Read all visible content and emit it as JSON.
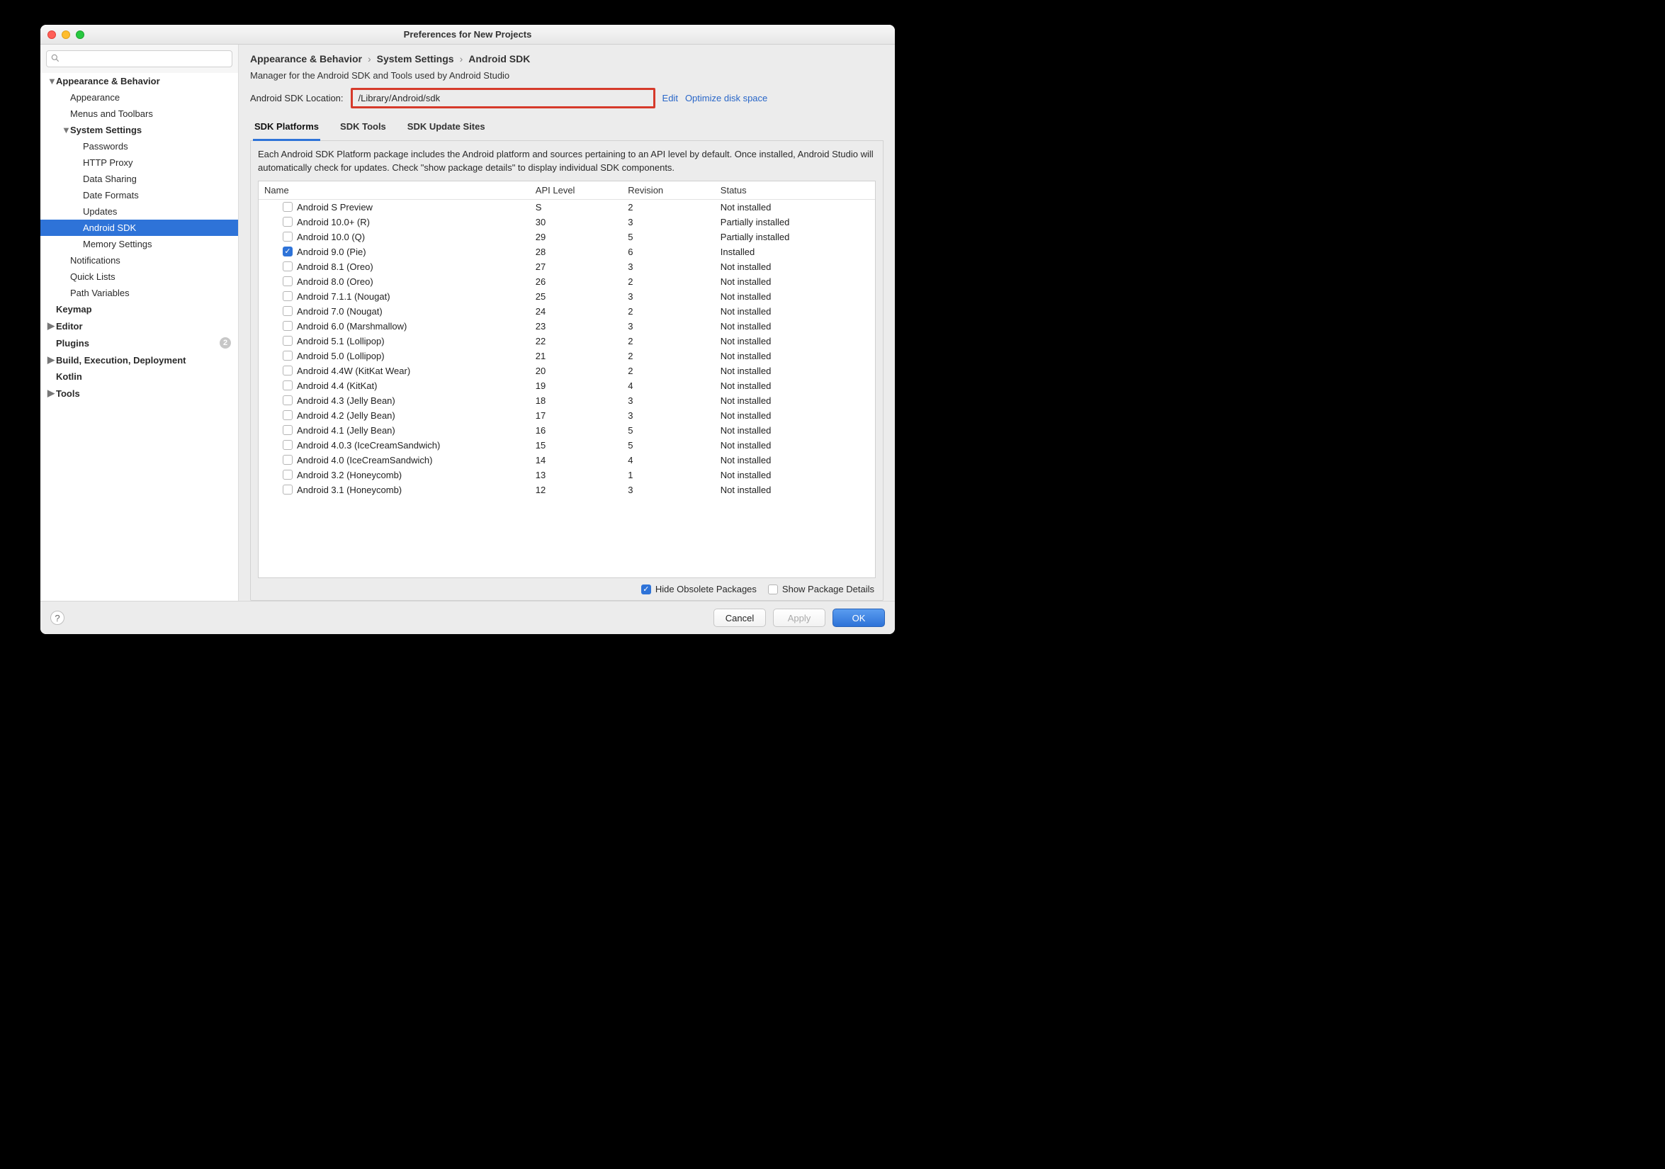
{
  "window": {
    "title": "Preferences for New Projects"
  },
  "sidebar": {
    "search_placeholder": "",
    "items": [
      {
        "label": "Appearance & Behavior",
        "bold": true,
        "expand": "down",
        "indent": 0
      },
      {
        "label": "Appearance",
        "indent": 1
      },
      {
        "label": "Menus and Toolbars",
        "indent": 1
      },
      {
        "label": "System Settings",
        "bold": true,
        "expand": "down",
        "indent": 1
      },
      {
        "label": "Passwords",
        "indent": 2
      },
      {
        "label": "HTTP Proxy",
        "indent": 2
      },
      {
        "label": "Data Sharing",
        "indent": 2
      },
      {
        "label": "Date Formats",
        "indent": 2
      },
      {
        "label": "Updates",
        "indent": 2
      },
      {
        "label": "Android SDK",
        "indent": 2,
        "selected": true
      },
      {
        "label": "Memory Settings",
        "indent": 2
      },
      {
        "label": "Notifications",
        "indent": 1
      },
      {
        "label": "Quick Lists",
        "indent": 1
      },
      {
        "label": "Path Variables",
        "indent": 1
      },
      {
        "label": "Keymap",
        "bold": true,
        "indent": 0
      },
      {
        "label": "Editor",
        "bold": true,
        "expand": "right",
        "indent": 0
      },
      {
        "label": "Plugins",
        "bold": true,
        "indent": 0,
        "badge": "2"
      },
      {
        "label": "Build, Execution, Deployment",
        "bold": true,
        "expand": "right",
        "indent": 0
      },
      {
        "label": "Kotlin",
        "bold": true,
        "indent": 0
      },
      {
        "label": "Tools",
        "bold": true,
        "expand": "right",
        "indent": 0
      }
    ]
  },
  "breadcrumb": [
    "Appearance & Behavior",
    "System Settings",
    "Android SDK"
  ],
  "subtitle": "Manager for the Android SDK and Tools used by Android Studio",
  "sdk": {
    "label": "Android SDK Location:",
    "path": "/Library/Android/sdk",
    "edit": "Edit",
    "optimize": "Optimize disk space"
  },
  "tabs": [
    "SDK Platforms",
    "SDK Tools",
    "SDK Update Sites"
  ],
  "activeTab": 0,
  "panelDesc": "Each Android SDK Platform package includes the Android platform and sources pertaining to an API level by default. Once installed, Android Studio will automatically check for updates. Check \"show package details\" to display individual SDK components.",
  "columns": [
    "Name",
    "API Level",
    "Revision",
    "Status"
  ],
  "rows": [
    {
      "name": "Android S Preview",
      "api": "S",
      "rev": "2",
      "status": "Not installed",
      "checked": false
    },
    {
      "name": "Android 10.0+ (R)",
      "api": "30",
      "rev": "3",
      "status": "Partially installed",
      "checked": false
    },
    {
      "name": "Android 10.0 (Q)",
      "api": "29",
      "rev": "5",
      "status": "Partially installed",
      "checked": false
    },
    {
      "name": "Android 9.0 (Pie)",
      "api": "28",
      "rev": "6",
      "status": "Installed",
      "checked": true
    },
    {
      "name": "Android 8.1 (Oreo)",
      "api": "27",
      "rev": "3",
      "status": "Not installed",
      "checked": false
    },
    {
      "name": "Android 8.0 (Oreo)",
      "api": "26",
      "rev": "2",
      "status": "Not installed",
      "checked": false
    },
    {
      "name": "Android 7.1.1 (Nougat)",
      "api": "25",
      "rev": "3",
      "status": "Not installed",
      "checked": false
    },
    {
      "name": "Android 7.0 (Nougat)",
      "api": "24",
      "rev": "2",
      "status": "Not installed",
      "checked": false
    },
    {
      "name": "Android 6.0 (Marshmallow)",
      "api": "23",
      "rev": "3",
      "status": "Not installed",
      "checked": false
    },
    {
      "name": "Android 5.1 (Lollipop)",
      "api": "22",
      "rev": "2",
      "status": "Not installed",
      "checked": false
    },
    {
      "name": "Android 5.0 (Lollipop)",
      "api": "21",
      "rev": "2",
      "status": "Not installed",
      "checked": false
    },
    {
      "name": "Android 4.4W (KitKat Wear)",
      "api": "20",
      "rev": "2",
      "status": "Not installed",
      "checked": false
    },
    {
      "name": "Android 4.4 (KitKat)",
      "api": "19",
      "rev": "4",
      "status": "Not installed",
      "checked": false
    },
    {
      "name": "Android 4.3 (Jelly Bean)",
      "api": "18",
      "rev": "3",
      "status": "Not installed",
      "checked": false
    },
    {
      "name": "Android 4.2 (Jelly Bean)",
      "api": "17",
      "rev": "3",
      "status": "Not installed",
      "checked": false
    },
    {
      "name": "Android 4.1 (Jelly Bean)",
      "api": "16",
      "rev": "5",
      "status": "Not installed",
      "checked": false
    },
    {
      "name": "Android 4.0.3 (IceCreamSandwich)",
      "api": "15",
      "rev": "5",
      "status": "Not installed",
      "checked": false
    },
    {
      "name": "Android 4.0 (IceCreamSandwich)",
      "api": "14",
      "rev": "4",
      "status": "Not installed",
      "checked": false
    },
    {
      "name": "Android 3.2 (Honeycomb)",
      "api": "13",
      "rev": "1",
      "status": "Not installed",
      "checked": false
    },
    {
      "name": "Android 3.1 (Honeycomb)",
      "api": "12",
      "rev": "3",
      "status": "Not installed",
      "checked": false
    }
  ],
  "footerChecks": {
    "hideObsolete": {
      "label": "Hide Obsolete Packages",
      "checked": true
    },
    "showDetails": {
      "label": "Show Package Details",
      "checked": false
    }
  },
  "buttons": {
    "cancel": "Cancel",
    "apply": "Apply",
    "ok": "OK"
  }
}
